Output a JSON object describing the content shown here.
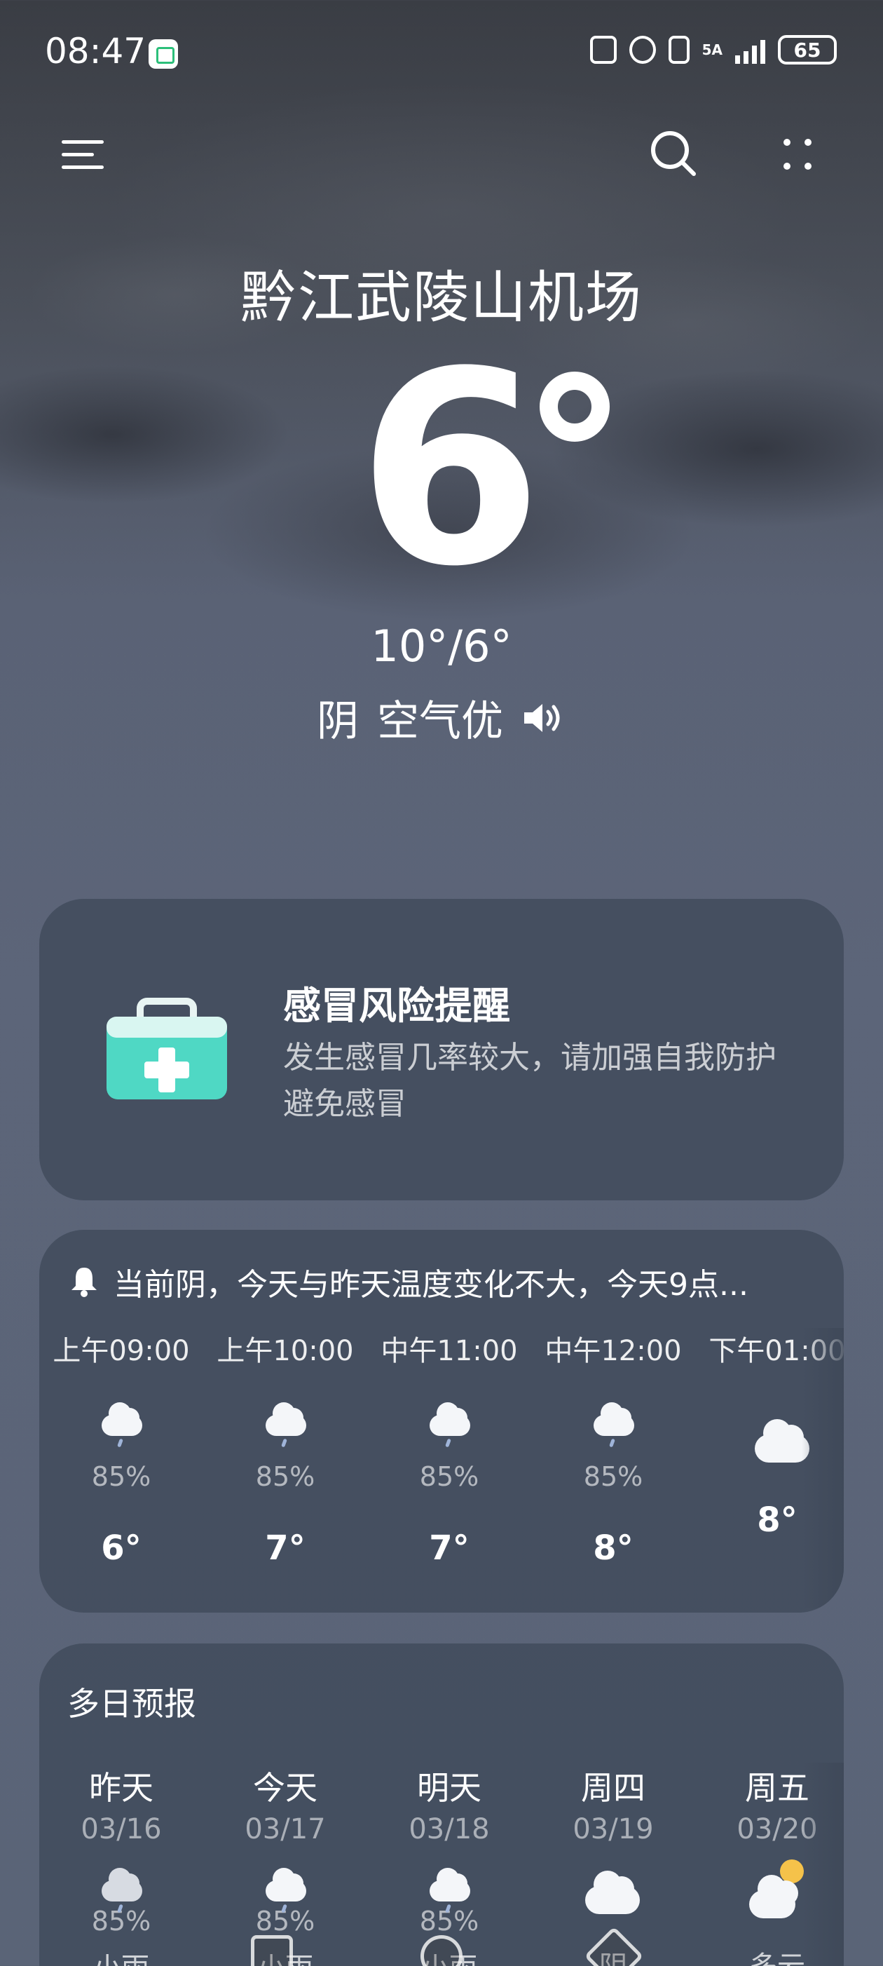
{
  "status_bar": {
    "time": "08:47",
    "network": "5A",
    "battery": "65"
  },
  "location": "黔江武陵山机场",
  "current": {
    "temp": "6",
    "range": "10°/6°",
    "condition": "阴",
    "air_quality": "空气优"
  },
  "alert": {
    "title": "感冒风险提醒",
    "text": "发生感冒几率较大，请加强自我防护避免感冒"
  },
  "hourly": {
    "summary": "当前阴，今天与昨天温度变化不大，今天9点...",
    "items": [
      {
        "time": "上午09:00",
        "pct": "85%",
        "temp": "6°",
        "icon": "light-rain-icon"
      },
      {
        "time": "上午10:00",
        "pct": "85%",
        "temp": "7°",
        "icon": "light-rain-icon"
      },
      {
        "time": "中午11:00",
        "pct": "85%",
        "temp": "7°",
        "icon": "light-rain-icon"
      },
      {
        "time": "中午12:00",
        "pct": "85%",
        "temp": "8°",
        "icon": "light-rain-icon"
      },
      {
        "time": "下午01:00",
        "pct": "",
        "temp": "8°",
        "icon": "cloudy-icon"
      }
    ]
  },
  "daily": {
    "title": "多日预报",
    "items": [
      {
        "name": "昨天",
        "date": "03/16",
        "pct": "85%",
        "cond": "小雨",
        "icon": "light-rain-icon"
      },
      {
        "name": "今天",
        "date": "03/17",
        "pct": "85%",
        "cond": "小雨",
        "icon": "light-rain-icon"
      },
      {
        "name": "明天",
        "date": "03/18",
        "pct": "85%",
        "cond": "小雨",
        "icon": "light-rain-icon"
      },
      {
        "name": "周四",
        "date": "03/19",
        "pct": "",
        "cond": "阴",
        "icon": "cloudy-icon"
      },
      {
        "name": "周五",
        "date": "03/20",
        "pct": "",
        "cond": "多云",
        "icon": "partly-cloudy-icon"
      }
    ]
  },
  "colors": {
    "accent": "#ffffff",
    "card": "#3e4858",
    "medkit": "#4fd8c4"
  }
}
